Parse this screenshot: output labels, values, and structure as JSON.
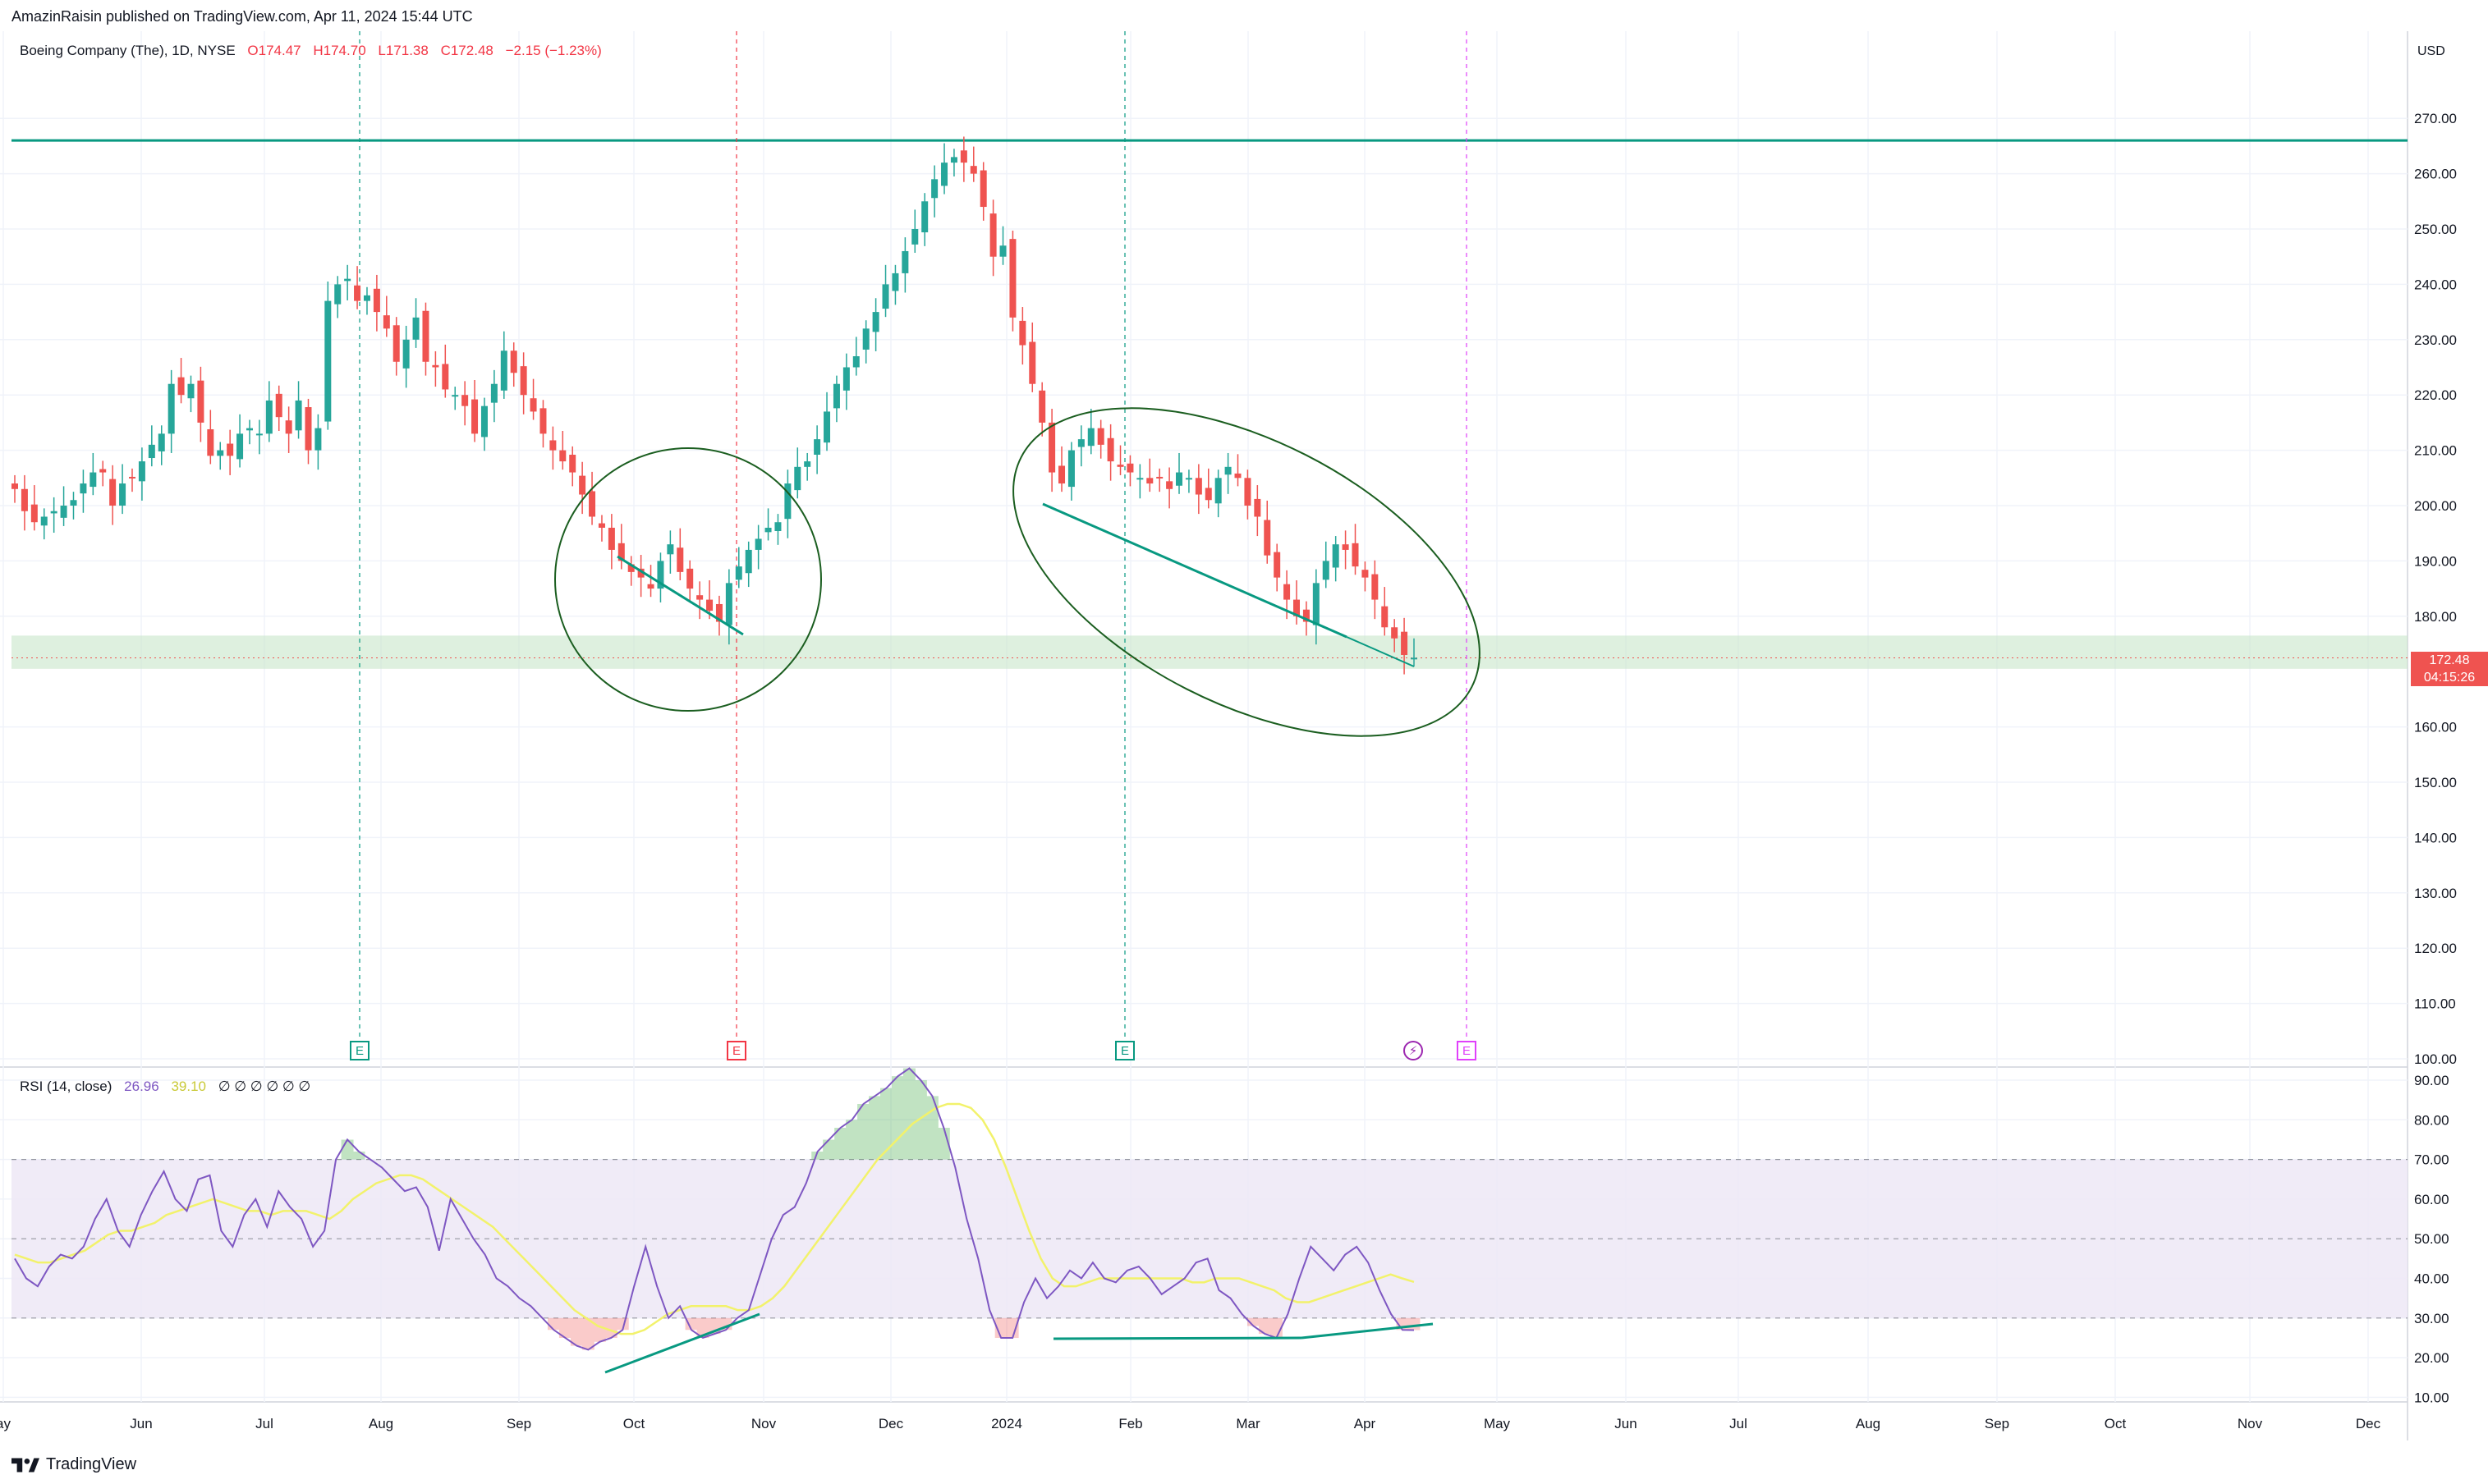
{
  "header": {
    "publisher_line": "AmazinRaisin published on TradingView.com, Apr 11, 2024 15:44 UTC"
  },
  "legend": {
    "symbol": "Boeing Company (The), 1D, NYSE",
    "open": "O174.47",
    "high": "H174.70",
    "low": "L171.38",
    "close": "C172.48",
    "change": "−2.15 (−1.23%)"
  },
  "rsi_legend": {
    "name": "RSI (14, close)",
    "rsi_value": "26.96",
    "ma_value": "39.10",
    "extra": "∅  ∅  ∅  ∅  ∅  ∅"
  },
  "price_axis": {
    "currency": "USD",
    "labels": [
      "270.00",
      "260.00",
      "250.00",
      "240.00",
      "230.00",
      "220.00",
      "210.00",
      "200.00",
      "190.00",
      "180.00",
      "160.00",
      "150.00",
      "140.00",
      "130.00",
      "120.00",
      "110.00",
      "100.00"
    ],
    "last_price": "172.48",
    "countdown": "04:15:26"
  },
  "rsi_axis": {
    "labels": [
      "90.00",
      "80.00",
      "70.00",
      "60.00",
      "50.00",
      "40.00",
      "30.00",
      "20.00",
      "10.00"
    ]
  },
  "time_axis": {
    "labels": [
      "ay",
      "Jun",
      "Jul",
      "Aug",
      "Sep",
      "Oct",
      "Nov",
      "Dec",
      "2024",
      "Feb",
      "Mar",
      "Apr",
      "May",
      "Jun",
      "Jul",
      "Aug",
      "Sep",
      "Oct",
      "Nov",
      "Dec"
    ]
  },
  "events": [
    {
      "letter": "E",
      "color": "#089981"
    },
    {
      "letter": "E",
      "color": "#f23645"
    },
    {
      "letter": "E",
      "color": "#089981"
    },
    {
      "letter": "⚡",
      "color": "#9c27b0"
    },
    {
      "letter": "E",
      "color": "#e040fb"
    }
  ],
  "brand": {
    "name": "TradingView"
  },
  "colors": {
    "up": "#089981",
    "down": "#f23645",
    "candle_up": "#26a69a",
    "candle_down": "#ef5350",
    "annotation_line": "#089981",
    "ellipse": "#1b5e20",
    "support_zone": "#c8e6c9",
    "rsi_line": "#7e57c2",
    "rsi_ma": "#f2f26b",
    "rsi_band": "#ede7f6"
  },
  "chart_data": {
    "type": "line",
    "series": [
      {
        "values": [
          203,
          199,
          197,
          198,
          199,
          200,
          201,
          204,
          206,
          206,
          200,
          204,
          205,
          208,
          211,
          213,
          222,
          220,
          222,
          215,
          209,
          210,
          209,
          213,
          214,
          213,
          219,
          216,
          213,
          219,
          210,
          214,
          237,
          240,
          241,
          237,
          238,
          235,
          232,
          226,
          230,
          234,
          226,
          225,
          221,
          220,
          218,
          213,
          218,
          222,
          228,
          224,
          220,
          217,
          213,
          210,
          208,
          206,
          202,
          198,
          196,
          192,
          190,
          188,
          187,
          185,
          190,
          193,
          188,
          185,
          183,
          181,
          179,
          186,
          189,
          192,
          194,
          196,
          197,
          204,
          207,
          208,
          212,
          217,
          222,
          225,
          227,
          232,
          235,
          240,
          242,
          246,
          250,
          255,
          259,
          262,
          263,
          262,
          260,
          254,
          245,
          247,
          234,
          229,
          222,
          215,
          206,
          204,
          210,
          212,
          214,
          211,
          208,
          207,
          206,
          205,
          204,
          205,
          203,
          206,
          205,
          202,
          201,
          205,
          207,
          205,
          200,
          198,
          191,
          187,
          183,
          180,
          179,
          186,
          190,
          193,
          192,
          189,
          187,
          183,
          178,
          176,
          173,
          172.5
        ],
        "ylim": [
          100,
          275
        ]
      },
      {
        "name": "RSI (14, close)",
        "values": [
          45,
          40,
          38,
          43,
          46,
          45,
          48,
          55,
          60,
          52,
          48,
          56,
          62,
          67,
          60,
          57,
          65,
          66,
          52,
          48,
          56,
          60,
          53,
          62,
          58,
          55,
          48,
          52,
          70,
          75,
          72,
          70,
          68,
          65,
          62,
          63,
          58,
          47,
          60,
          55,
          50,
          46,
          40,
          38,
          35,
          33,
          30,
          27,
          25,
          23,
          22,
          24,
          25,
          27,
          38,
          48,
          38,
          30,
          33,
          27,
          25,
          26,
          27,
          30,
          32,
          41,
          50,
          56,
          58,
          64,
          72,
          75,
          78,
          80,
          84,
          86,
          88,
          91,
          93,
          90,
          86,
          78,
          68,
          55,
          45,
          32,
          25,
          25,
          34,
          40,
          35,
          38,
          42,
          40,
          44,
          40,
          39,
          42,
          43,
          40,
          36,
          38,
          40,
          44,
          45,
          37,
          35,
          31,
          28,
          26,
          25,
          31,
          40,
          48,
          45,
          42,
          46,
          48,
          44,
          37,
          31,
          27,
          26.96
        ],
        "ylim": [
          5,
          95
        ]
      },
      {
        "name": "RSI MA",
        "values": [
          46,
          45,
          44,
          44,
          45,
          46,
          47,
          49,
          51,
          52,
          52,
          53,
          54,
          56,
          57,
          58,
          59,
          60,
          59,
          58,
          57,
          57,
          56,
          57,
          57,
          57,
          56,
          55,
          57,
          60,
          62,
          64,
          65,
          66,
          66,
          65,
          63,
          61,
          59,
          57,
          55,
          53,
          50,
          47,
          44,
          41,
          38,
          35,
          32,
          30,
          28,
          27,
          26,
          26,
          27,
          29,
          31,
          32,
          33,
          33,
          33,
          33,
          32,
          32,
          33,
          35,
          38,
          42,
          46,
          50,
          54,
          58,
          62,
          66,
          70,
          73,
          76,
          79,
          81,
          83,
          84,
          84,
          83,
          80,
          75,
          68,
          60,
          52,
          45,
          40,
          38,
          38,
          39,
          40,
          40,
          40,
          40,
          40,
          40,
          40,
          40,
          39,
          39,
          40,
          40,
          40,
          39,
          38,
          37,
          35,
          34,
          34,
          35,
          36,
          37,
          38,
          39,
          40,
          41,
          40,
          39.1
        ],
        "ylim": [
          5,
          95
        ]
      }
    ],
    "ylim": [
      100,
      275
    ],
    "rsi_levels": [
      70,
      50,
      30
    ]
  }
}
